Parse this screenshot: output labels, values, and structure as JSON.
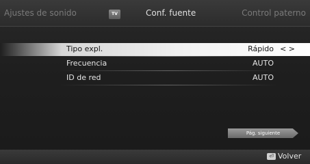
{
  "header": {
    "tab_left": "Ajustes de sonido",
    "tab_center": "Conf. fuente",
    "tab_right": "Control paterno",
    "tv_badge": "TV"
  },
  "settings": {
    "rows": [
      {
        "label": "Tipo expl.",
        "value": "Rápido",
        "arrows": "< >"
      },
      {
        "label": "Frecuencia",
        "value": "AUTO"
      },
      {
        "label": "ID de red",
        "value": "AUTO"
      }
    ]
  },
  "footer": {
    "next_page": "Pág. siguiente",
    "back_icon": "⏎",
    "back_label": "Volver"
  }
}
